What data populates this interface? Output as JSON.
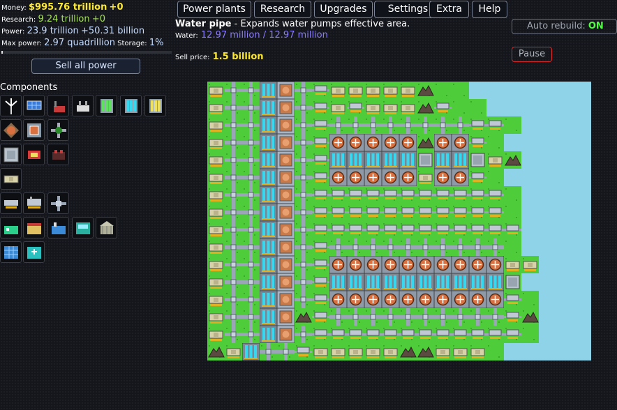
{
  "stats": {
    "money_label": "Money:",
    "money_value": "$995.76 trillion",
    "money_delta": "+0",
    "research_label": "Research:",
    "research_value": "9.24 trillion",
    "research_delta": "+0",
    "power_label": "Power:",
    "power_value": "23.9 trillion",
    "power_delta": "+50.31 billion",
    "maxpower_label": "Max power:",
    "maxpower_value": "2.97 quadrillion",
    "storage_label": "Storage:",
    "storage_value": "1%",
    "storage_fraction": 0.01
  },
  "sell_all_label": "Sell all power",
  "components_title": "Components",
  "components": [
    {
      "name": "wind-turbine-icon"
    },
    {
      "name": "solar-panel-icon"
    },
    {
      "name": "coal-plant-icon"
    },
    {
      "name": "gas-plant-icon"
    },
    {
      "name": "battery-green-icon"
    },
    {
      "name": "battery-blue-icon"
    },
    {
      "name": "battery-yellow-icon"
    },
    {
      "name": "heat-exchanger-icon"
    },
    {
      "name": "cooling-tower-icon"
    },
    {
      "name": "pipe-junction-icon"
    },
    {
      "name": "metal-block-icon"
    },
    {
      "name": "reactor-red-icon"
    },
    {
      "name": "reactor-dark-icon"
    },
    {
      "name": "cash-icon"
    },
    {
      "name": "pump-small-icon"
    },
    {
      "name": "pump-large-icon"
    },
    {
      "name": "water-pipe-icon"
    },
    {
      "name": "office-icon"
    },
    {
      "name": "shop-icon"
    },
    {
      "name": "factory-icon"
    },
    {
      "name": "lab-icon"
    },
    {
      "name": "bank-icon"
    },
    {
      "name": "apartments-icon"
    },
    {
      "name": "hospital-icon"
    }
  ],
  "top_menu": [
    "Power plants",
    "Research",
    "Upgrades",
    "Settings",
    "Extra",
    "Help"
  ],
  "selected": {
    "title": "Water pipe",
    "description": " - Expands water pumps effective area.",
    "water_label": "Water:",
    "water_value": "12.97 million / 12.97 million",
    "sell_label": "Sell price:",
    "sell_value": "1.5 billion"
  },
  "auto_rebuild": {
    "label": "Auto rebuild:",
    "value": "ON"
  },
  "pause_label": "Pause",
  "colors": {
    "grass": "#4fcc3a",
    "water": "#8fd3e8",
    "accent": "#ffe92e",
    "water_text": "#8a7cff"
  },
  "map": {
    "legend": {
      "c": "cash",
      "p": "pipe",
      "r": "reactor",
      "x": "heat-exchanger",
      "b": "battery",
      "m": "metal-block",
      "k": "rock",
      "g": "grass",
      "w": "water",
      "v": "vent"
    },
    "rows": [
      "cppbxpvccccckggw",
      "cppbxpvcvccckvggw",
      "cppbxpvppppppppvvgw",
      "cppbxpvrrrrrkrrvg",
      "cppbxpvbbbbbmbbmck",
      "cppbxpvrrrrrcrrvg",
      "cppbxpvvvvvvvvvvvgw",
      "cppbxpvvvvvvvvvvvgw",
      "cppbxpvvvvvvvvvvvvw",
      "cppbxpvppppppppppgw",
      "cppbxpvrrrrrrrrrrcc",
      "cppbxpvbbbbbbbbbbm",
      "cppbxpvrrrrrrrrrrvg",
      "cppbxkvppppppppppvk",
      "cppbxpvvvvvvvvvvvvg",
      "kcbppvccccckkcccg"
    ]
  }
}
